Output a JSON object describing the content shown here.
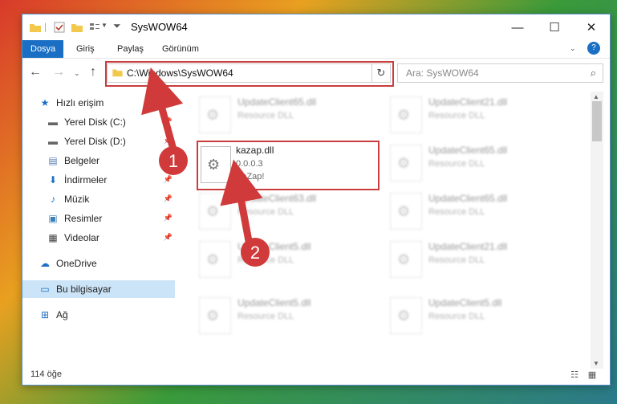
{
  "window": {
    "title": "SysWOW64"
  },
  "controls": {
    "minimize": "—",
    "maximize": "☐",
    "close": "✕"
  },
  "ribbon": {
    "tabs": [
      "Dosya",
      "Giriş",
      "Paylaş",
      "Görünüm"
    ],
    "help": "?"
  },
  "nav": {
    "address": "C:\\Windows\\SysWOW64",
    "search_placeholder": "Ara: SysWOW64"
  },
  "sidebar": {
    "items": [
      {
        "label": "Hızlı erişim"
      },
      {
        "label": "Yerel Disk (C:)"
      },
      {
        "label": "Yerel Disk (D:)"
      },
      {
        "label": "Belgeler"
      },
      {
        "label": "İndirmeler"
      },
      {
        "label": "Müzik"
      },
      {
        "label": "Resimler"
      },
      {
        "label": "Videolar"
      },
      {
        "label": "OneDrive"
      },
      {
        "label": "Bu bilgisayar"
      },
      {
        "label": "Ağ"
      }
    ]
  },
  "files": {
    "selected": {
      "name": "kazap.dll",
      "version": "0.0.0.3",
      "company": "KaZap!"
    },
    "blurred": [
      {
        "name": "UpdateClient65.dll",
        "desc": "Resource DLL"
      },
      {
        "name": "UpdateClient21.dll",
        "desc": "Resource DLL"
      },
      {
        "name": "UpdateClient65.dll",
        "desc": "Resource DLL"
      },
      {
        "name": "UpdateClient63.dll",
        "desc": "Resource DLL"
      },
      {
        "name": "UpdateClient65.dll",
        "desc": "Resource DLL"
      },
      {
        "name": "UpdateClient5.dll",
        "desc": "Resource DLL"
      },
      {
        "name": "UpdateClient21.dll",
        "desc": "Resource DLL"
      },
      {
        "name": "UpdateClient5.dll",
        "desc": "Resource DLL"
      },
      {
        "name": "UpdateClient5.dll",
        "desc": "Resource DLL"
      }
    ]
  },
  "status": {
    "count": "114 öğe"
  },
  "annotations": {
    "step1": "1",
    "step2": "2"
  }
}
